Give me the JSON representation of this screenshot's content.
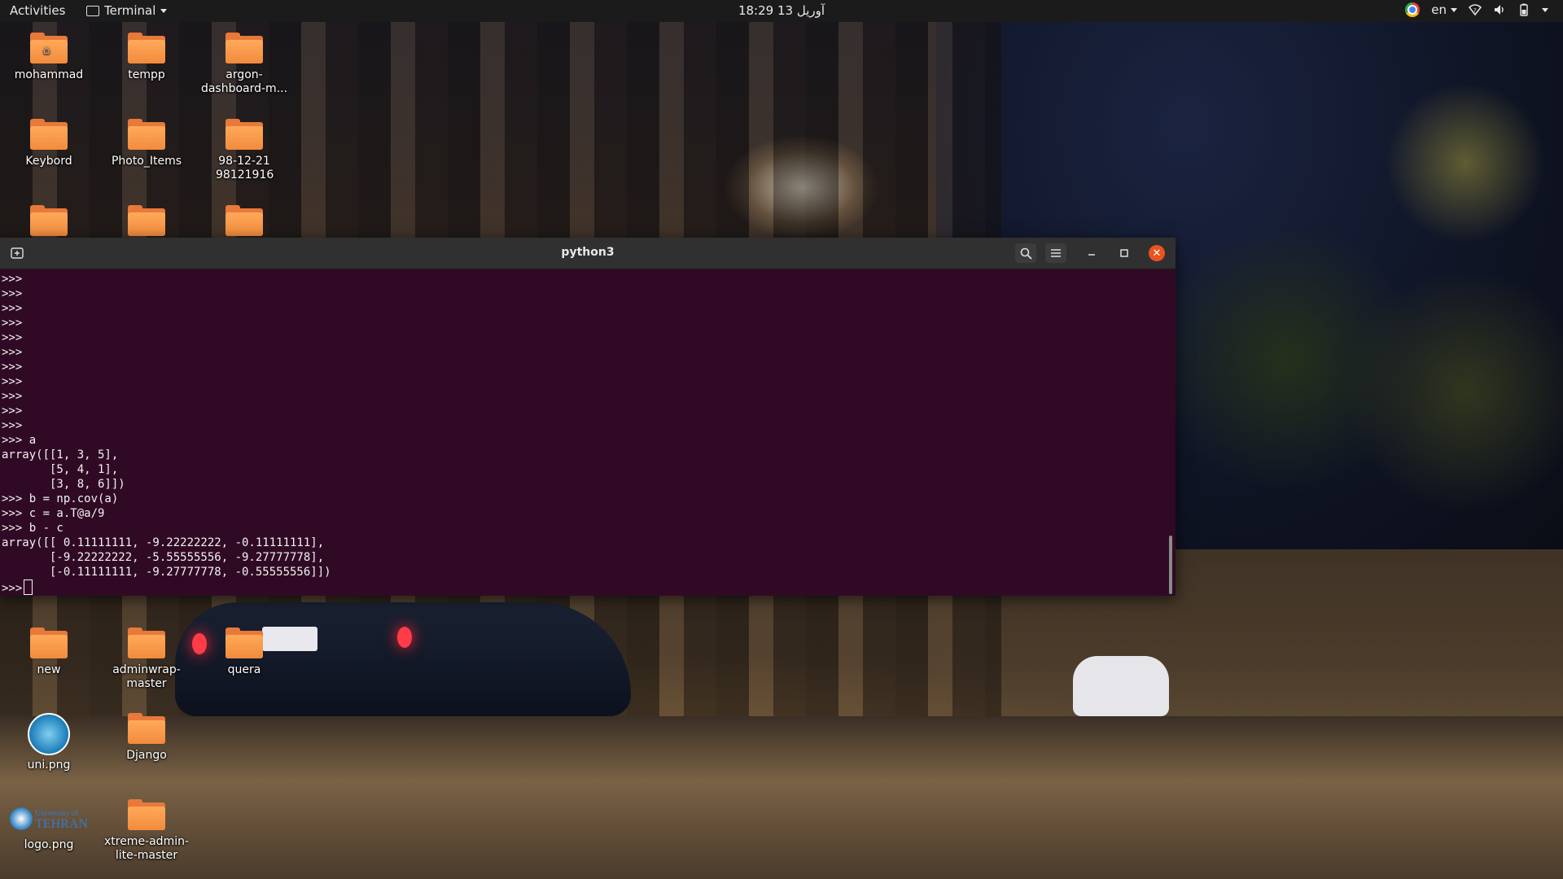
{
  "topbar": {
    "activities": "Activities",
    "app_name": "Terminal",
    "clock": "آوریل 13  18:29",
    "language": "en"
  },
  "desktop": {
    "icons": [
      {
        "label": "mohammad",
        "type": "home-folder"
      },
      {
        "label": "tempp",
        "type": "folder"
      },
      {
        "label": "argon-dashboard-m...",
        "type": "folder"
      },
      {
        "label": "Keybord",
        "type": "folder"
      },
      {
        "label": "Photo_Items",
        "type": "folder"
      },
      {
        "label": "98-12-21 98121916",
        "type": "folder"
      },
      {
        "label": "new",
        "type": "folder"
      },
      {
        "label": "adminwrap-master",
        "type": "folder"
      },
      {
        "label": "quera",
        "type": "folder"
      },
      {
        "label": "uni.png",
        "type": "image"
      },
      {
        "label": "Django",
        "type": "folder"
      },
      {
        "label": "logo.png",
        "type": "image",
        "logo_text_small": "University of",
        "logo_text_big": "TEHRAN"
      },
      {
        "label": "xtreme-admin-lite-master",
        "type": "folder"
      }
    ]
  },
  "terminal": {
    "title": "python3",
    "lines": [
      ">>>",
      ">>>",
      ">>>",
      ">>>",
      ">>>",
      ">>>",
      ">>>",
      ">>>",
      ">>>",
      ">>>",
      ">>>",
      ">>> a",
      "array([[1, 3, 5],",
      "       [5, 4, 1],",
      "       [3, 8, 6]])",
      ">>> b = np.cov(a)",
      ">>> c = a.T@a/9",
      ">>> b - c",
      "array([[ 0.11111111, -9.22222222, -0.11111111],",
      "       [-9.22222222, -5.55555556, -9.27777778],",
      "       [-0.11111111, -9.27777778, -0.55555556]])"
    ],
    "prompt": ">>> "
  },
  "colors": {
    "terminal_bg": "#300a24",
    "header_bg": "#303030",
    "close_accent": "#e95420",
    "folder_orange": "#f28b3c"
  }
}
